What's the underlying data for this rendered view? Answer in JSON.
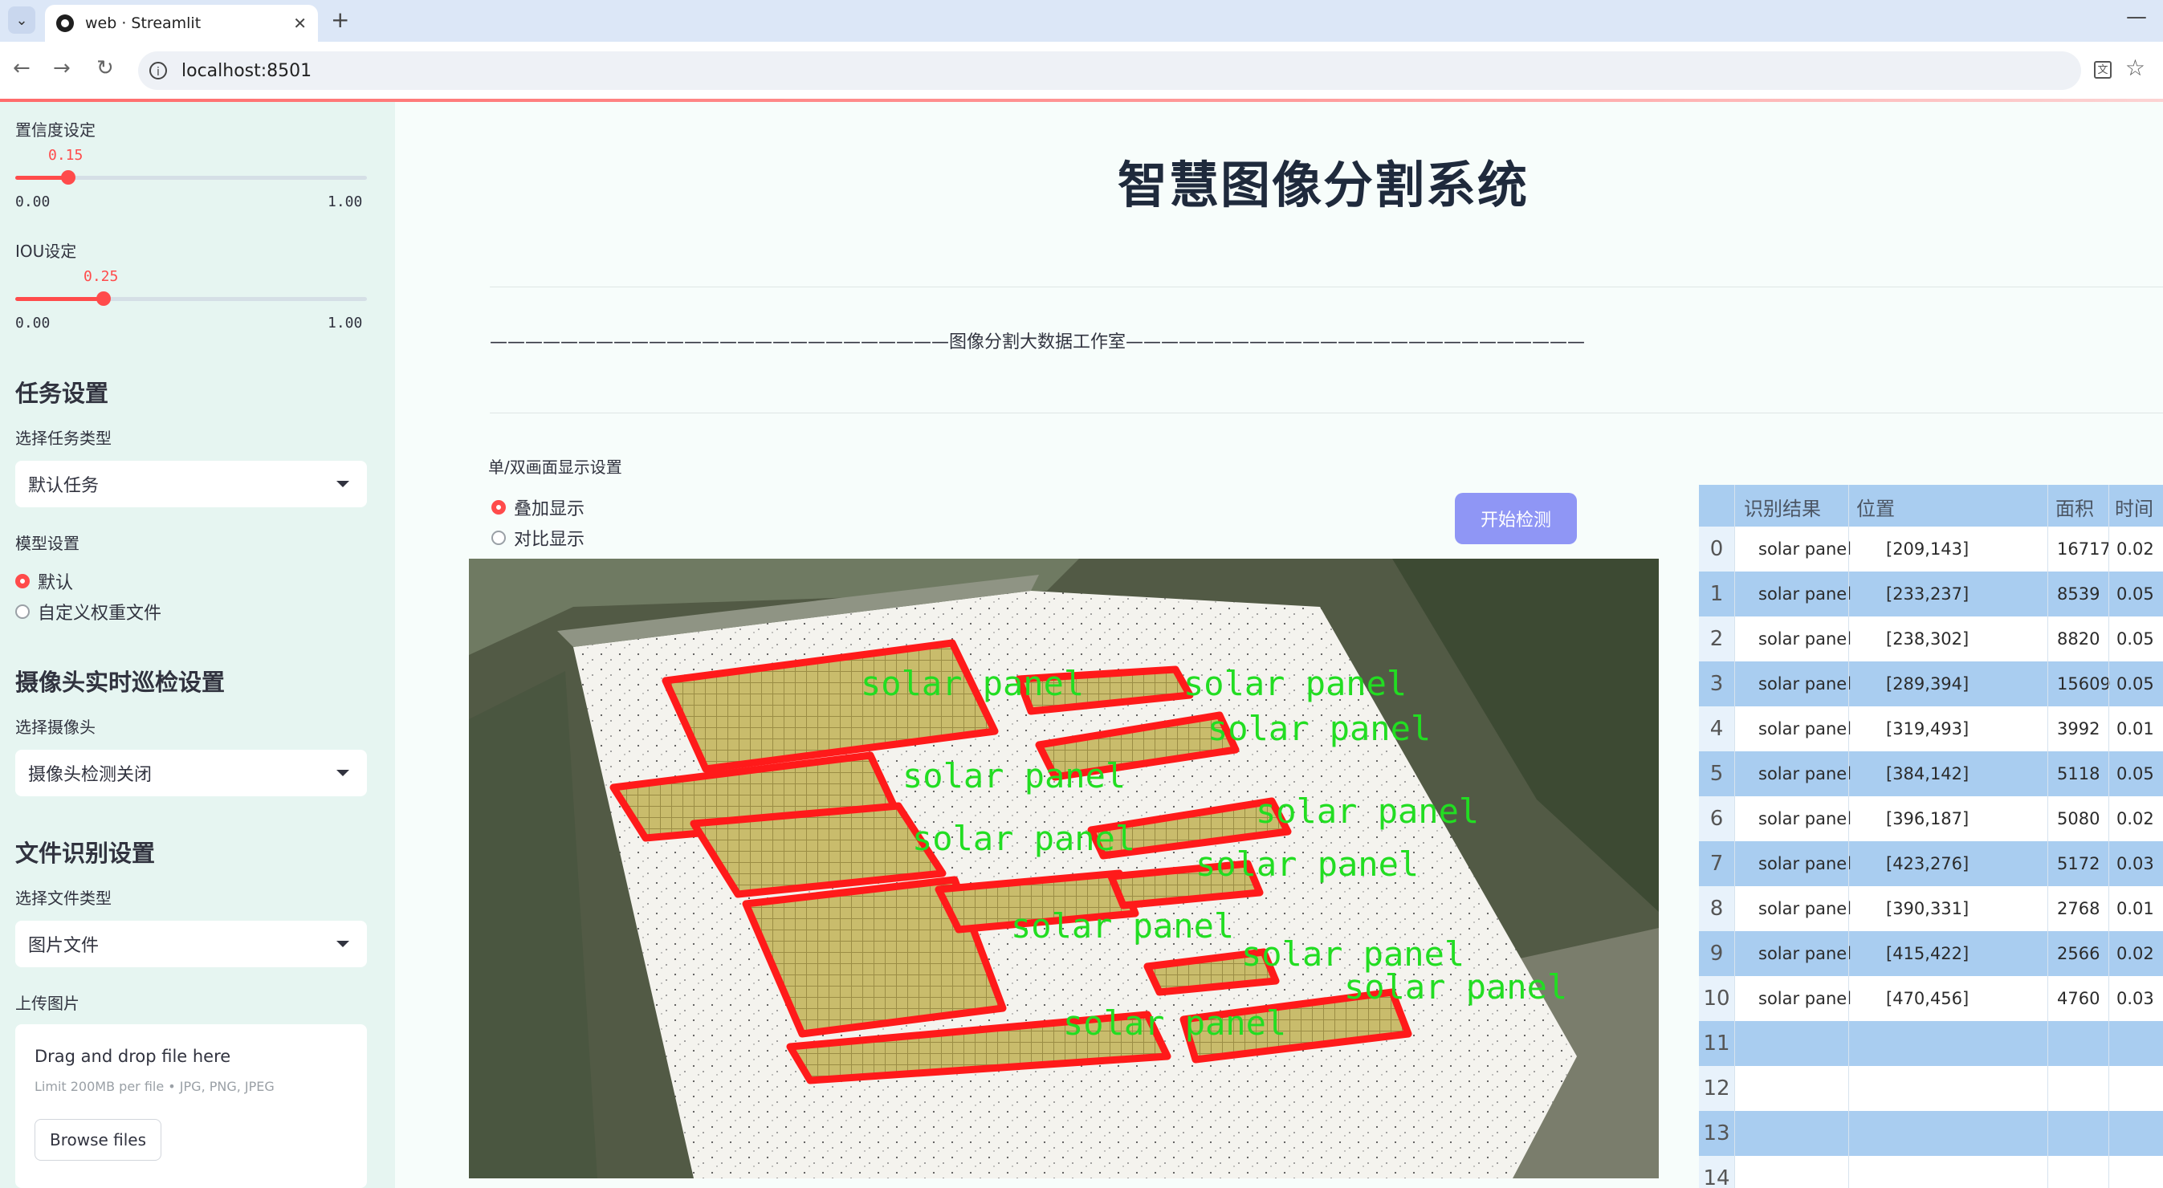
{
  "browser": {
    "tab_title": "web · Streamlit",
    "url": "localhost:8501"
  },
  "sidebar": {
    "confidence": {
      "label": "置信度设定",
      "value": "0.15",
      "min": "0.00",
      "max": "1.00",
      "fraction": 0.15
    },
    "iou": {
      "label": "IOU设定",
      "value": "0.25",
      "min": "0.00",
      "max": "1.00",
      "fraction": 0.25
    },
    "task_settings": {
      "heading": "任务设置",
      "select_label": "选择任务类型",
      "selected": "默认任务"
    },
    "model_settings": {
      "label": "模型设置",
      "options": [
        "默认",
        "自定义权重文件"
      ],
      "selected_index": 0
    },
    "camera_settings": {
      "heading": "摄像头实时巡检设置",
      "select_label": "选择摄像头",
      "selected": "摄像头检测关闭"
    },
    "file_settings": {
      "heading": "文件识别设置",
      "select_label": "选择文件类型",
      "selected": "图片文件",
      "upload_label": "上传图片",
      "drop_text": "Drag and drop file here",
      "limit_text": "Limit 200MB per file • JPG, PNG, JPEG",
      "browse_label": "Browse files"
    }
  },
  "main": {
    "title": "智慧图像分割系统",
    "subtitle": "——————————————————————————图像分割大数据工作室——————————————————————————",
    "display_label": "单/双画面显示设置",
    "display_options": [
      "叠加显示",
      "对比显示"
    ],
    "display_selected_index": 0,
    "start_button": "开始检测",
    "detection_label": "solar panel"
  },
  "results_table": {
    "columns": [
      "识别结果",
      "位置",
      "面积",
      "时间"
    ],
    "rows": [
      {
        "index": "0",
        "result": "solar panel",
        "position": "[209,143]",
        "area": "16717",
        "time": "0.02"
      },
      {
        "index": "1",
        "result": "solar panel",
        "position": "[233,237]",
        "area": "8539",
        "time": "0.05"
      },
      {
        "index": "2",
        "result": "solar panel",
        "position": "[238,302]",
        "area": "8820",
        "time": "0.05"
      },
      {
        "index": "3",
        "result": "solar panel",
        "position": "[289,394]",
        "area": "15609",
        "time": "0.05"
      },
      {
        "index": "4",
        "result": "solar panel",
        "position": "[319,493]",
        "area": "3992",
        "time": "0.01"
      },
      {
        "index": "5",
        "result": "solar panel",
        "position": "[384,142]",
        "area": "5118",
        "time": "0.05"
      },
      {
        "index": "6",
        "result": "solar panel",
        "position": "[396,187]",
        "area": "5080",
        "time": "0.02"
      },
      {
        "index": "7",
        "result": "solar panel",
        "position": "[423,276]",
        "area": "5172",
        "time": "0.03"
      },
      {
        "index": "8",
        "result": "solar panel",
        "position": "[390,331]",
        "area": "2768",
        "time": "0.01"
      },
      {
        "index": "9",
        "result": "solar panel",
        "position": "[415,422]",
        "area": "2566",
        "time": "0.02"
      },
      {
        "index": "10",
        "result": "solar panel",
        "position": "[470,456]",
        "area": "4760",
        "time": "0.03"
      },
      {
        "index": "11",
        "result": "",
        "position": "",
        "area": "",
        "time": ""
      },
      {
        "index": "12",
        "result": "",
        "position": "",
        "area": "",
        "time": ""
      },
      {
        "index": "13",
        "result": "",
        "position": "",
        "area": "",
        "time": ""
      },
      {
        "index": "14",
        "result": "",
        "position": "",
        "area": "",
        "time": ""
      }
    ]
  },
  "colors": {
    "accent": "#ff4b4b",
    "button": "#8f96f5",
    "table_header": "#a9cdf0",
    "detection_box": "#ff1a1a",
    "detection_text": "#22dd22"
  }
}
